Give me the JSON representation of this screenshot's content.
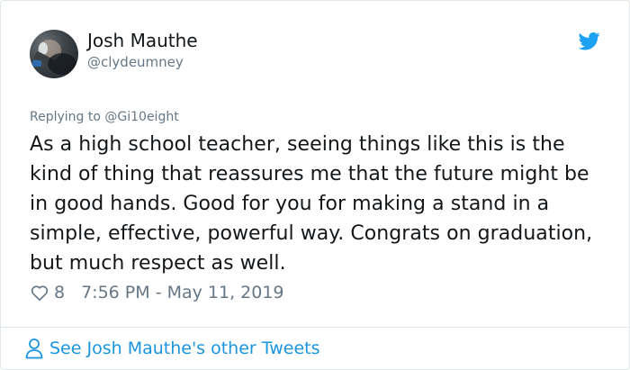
{
  "tweet": {
    "display_name": "Josh Mauthe",
    "handle": "@clydeumney",
    "replying_prefix": "Replying to",
    "replying_to": "@Gi10eight",
    "text": "As a high school teacher, seeing things like this is the kind of thing that reassures me that the future might be in good hands. Good for you for making a stand in a simple, effective, powerful way. Congrats on graduation, but much respect as well.",
    "like_count": "8",
    "timestamp": "7:56 PM - May 11, 2019"
  },
  "footer": {
    "link_label": "See Josh Mauthe's other Tweets"
  },
  "colors": {
    "twitter_blue": "#1da1f2",
    "link_blue": "#1b95e0",
    "muted_gray": "#657786",
    "text_dark": "#14171a"
  },
  "icons": {
    "brand": "twitter-bird-icon",
    "like": "heart-icon",
    "profile": "person-icon"
  }
}
